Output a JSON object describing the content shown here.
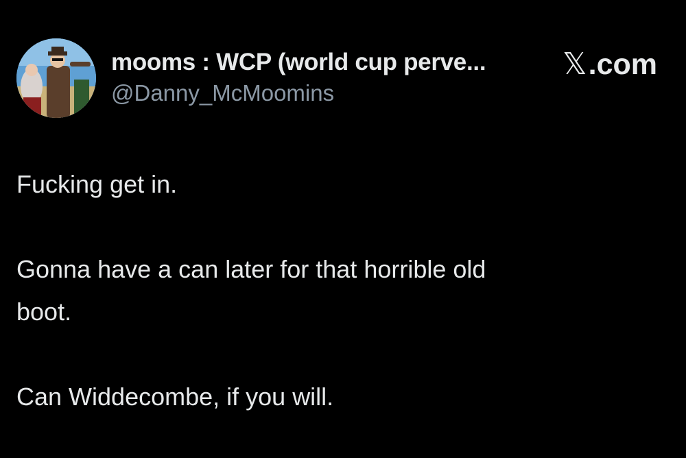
{
  "author": {
    "display_name": "mooms : WCP (world cup perve...",
    "handle": "@Danny_McMoomins",
    "avatar_icon": "profile-photo-icon"
  },
  "brand": {
    "glyph": "𝕏",
    "text": ".com"
  },
  "tweet": {
    "lines": [
      "Fucking get in.",
      "Gonna have a can later for that horrible old",
      "boot.",
      "Can Widdecombe, if you will."
    ]
  },
  "colors": {
    "background": "#000000",
    "primary_text": "#e7e9ea",
    "secondary_text": "#8b98a5"
  }
}
